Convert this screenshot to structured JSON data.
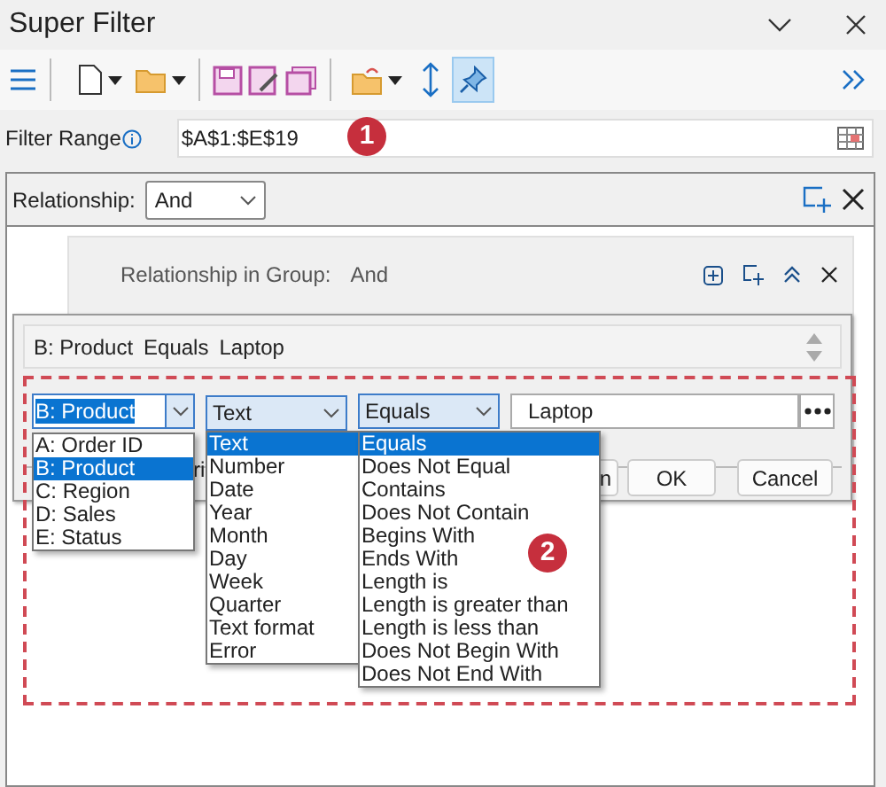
{
  "window": {
    "title": "Super Filter"
  },
  "toolbar": {
    "pin_selected": true
  },
  "filter_range": {
    "label": "Filter Range",
    "value": "$A$1:$E$19"
  },
  "callouts": [
    "1",
    "2"
  ],
  "relationship": {
    "label": "Relationship:",
    "value": "And"
  },
  "group": {
    "label": "Relationship in Group:",
    "value": "And"
  },
  "condition_summary": [
    "B: Product",
    "Equals",
    "Laptop"
  ],
  "condition": {
    "column": "B: Product",
    "type": "Text",
    "operator": "Equals",
    "value": "Laptop"
  },
  "column_options": [
    {
      "label": "A: Order ID",
      "selected": false
    },
    {
      "label": "B: Product",
      "selected": true
    },
    {
      "label": "C: Region",
      "selected": false
    },
    {
      "label": "D: Sales",
      "selected": false
    },
    {
      "label": "E: Status",
      "selected": false
    }
  ],
  "type_options": [
    {
      "label": "Text",
      "selected": true
    },
    {
      "label": "Number",
      "selected": false
    },
    {
      "label": "Date",
      "selected": false
    },
    {
      "label": "Year",
      "selected": false
    },
    {
      "label": "Month",
      "selected": false
    },
    {
      "label": "Day",
      "selected": false
    },
    {
      "label": "Week",
      "selected": false
    },
    {
      "label": "Quarter",
      "selected": false
    },
    {
      "label": "Text format",
      "selected": false
    },
    {
      "label": "Error",
      "selected": false
    }
  ],
  "operator_options": [
    {
      "label": "Equals",
      "selected": true
    },
    {
      "label": "Does Not Equal",
      "selected": false
    },
    {
      "label": "Contains",
      "selected": false
    },
    {
      "label": "Does Not Contain",
      "selected": false
    },
    {
      "label": "Begins With",
      "selected": false
    },
    {
      "label": "Ends With",
      "selected": false
    },
    {
      "label": "Length is",
      "selected": false
    },
    {
      "label": "Length is greater than",
      "selected": false
    },
    {
      "label": "Length is less than",
      "selected": false
    },
    {
      "label": "Does Not Begin With",
      "selected": false
    },
    {
      "label": "Does Not End With",
      "selected": false
    }
  ],
  "covered_text": "ri",
  "dialog_buttons": [
    "n",
    "OK",
    "Cancel"
  ]
}
